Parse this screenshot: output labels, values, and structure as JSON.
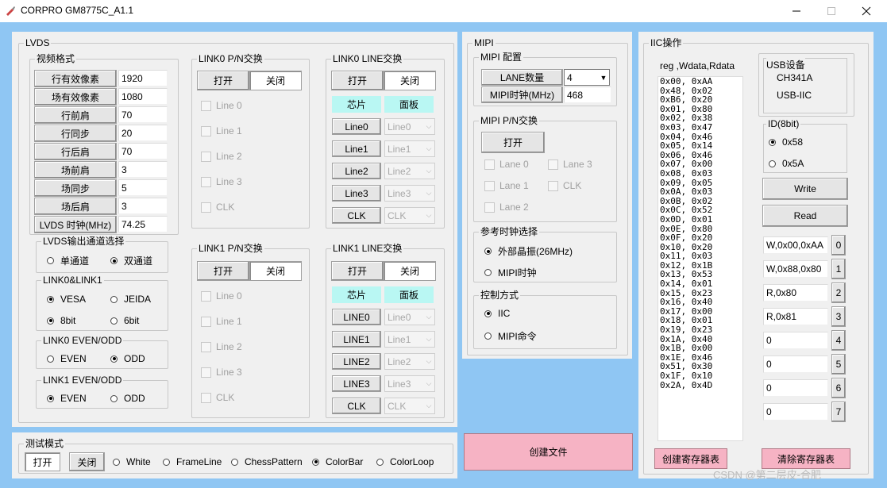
{
  "window": {
    "title": "CORPRO GM8775C_A1.1",
    "minimize_icon": "minimize-icon",
    "maximize_icon": "maximize-icon",
    "close_icon": "close-icon"
  },
  "lvds": {
    "title": "LVDS",
    "video_format": {
      "title": "视频格式",
      "rows": [
        {
          "label": "行有效像素",
          "value": "1920"
        },
        {
          "label": "场有效像素",
          "value": "1080"
        },
        {
          "label": "行前肩",
          "value": "70"
        },
        {
          "label": "行同步",
          "value": "20"
        },
        {
          "label": "行后肩",
          "value": "70"
        },
        {
          "label": "场前肩",
          "value": "3"
        },
        {
          "label": "场同步",
          "value": "5"
        },
        {
          "label": "场后肩",
          "value": "3"
        },
        {
          "label": "LVDS 时钟(MHz)",
          "value": "74.25"
        }
      ]
    },
    "output_channel": {
      "title": "LVDS输出通道选择",
      "options": [
        "单通道",
        "双通道"
      ],
      "selected": 1
    },
    "link": {
      "title": "LINK0&LINK1",
      "std_options": [
        "VESA",
        "JEIDA"
      ],
      "std_selected": 0,
      "bit_options": [
        "8bit",
        "6bit"
      ],
      "bit_selected": 0
    },
    "link0_evenodd": {
      "title": "LINK0 EVEN/ODD",
      "options": [
        "EVEN",
        "ODD"
      ],
      "selected": 1
    },
    "link1_evenodd": {
      "title": "LINK1 EVEN/ODD",
      "options": [
        "EVEN",
        "ODD"
      ],
      "selected": 0
    },
    "link0_pn": {
      "title": "LINK0 P/N交换",
      "open": "打开",
      "close": "关闭",
      "lines": [
        "Line 0",
        "Line 1",
        "Line 2",
        "Line 3",
        "CLK"
      ]
    },
    "link1_pn": {
      "title": "LINK1 P/N交换",
      "open": "打开",
      "close": "关闭",
      "lines": [
        "Line 0",
        "Line 1",
        "Line 2",
        "Line 3",
        "CLK"
      ]
    },
    "link0_line": {
      "title": "LINK0 LINE交换",
      "open": "打开",
      "close": "关闭",
      "chip": "芯片",
      "panel": "面板",
      "rows": [
        {
          "chip": "Line0",
          "panel": "Line0"
        },
        {
          "chip": "Line1",
          "panel": "Line1"
        },
        {
          "chip": "Line2",
          "panel": "Line2"
        },
        {
          "chip": "Line3",
          "panel": "Line3"
        },
        {
          "chip": "CLK",
          "panel": "CLK"
        }
      ]
    },
    "link1_line": {
      "title": "LINK1 LINE交换",
      "open": "打开",
      "close": "关闭",
      "chip": "芯片",
      "panel": "面板",
      "rows": [
        {
          "chip": "LINE0",
          "panel": "Line0"
        },
        {
          "chip": "LINE1",
          "panel": "Line1"
        },
        {
          "chip": "LINE2",
          "panel": "Line2"
        },
        {
          "chip": "LINE3",
          "panel": "Line3"
        },
        {
          "chip": "CLK",
          "panel": "CLK"
        }
      ]
    }
  },
  "test_mode": {
    "title": "测试模式",
    "open": "打开",
    "close": "关闭",
    "options": [
      "White",
      "FrameLine",
      "ChessPattern",
      "ColorBar",
      "ColorLoop"
    ],
    "selected": 3
  },
  "mipi": {
    "title": "MIPI",
    "config": {
      "title": "MIPI 配置",
      "lane_label": "LANE数量",
      "lane_value": "4",
      "clock_label": "MIPI时钟(MHz)",
      "clock_value": "468"
    },
    "pn": {
      "title": "MIPI P/N交换",
      "open": "打开",
      "lanes": [
        "Lane 0",
        "Lane 3",
        "Lane 1",
        "CLK",
        "Lane 2"
      ]
    },
    "ref_clock": {
      "title": "参考时钟选择",
      "options": [
        "外部晶振(26MHz)",
        "MIPI时钟"
      ],
      "selected": 0
    },
    "control": {
      "title": "控制方式",
      "options": [
        "IIC",
        "MIPI命令"
      ],
      "selected": 0
    }
  },
  "create_file_button": "创建文件",
  "iic": {
    "title": "IIC操作",
    "list_header": "reg ,Wdata,Rdata",
    "list": [
      "0x00, 0xAA",
      "0x48, 0x02",
      "0xB6, 0x20",
      "0x01, 0x80",
      "0x02, 0x38",
      "0x03, 0x47",
      "0x04, 0x46",
      "0x05, 0x14",
      "0x06, 0x46",
      "0x07, 0x00",
      "0x08, 0x03",
      "0x09, 0x05",
      "0x0A, 0x03",
      "0x0B, 0x02",
      "0x0C, 0x52",
      "0x0D, 0x01",
      "0x0E, 0x80",
      "0x0F, 0x20",
      "0x10, 0x20",
      "0x11, 0x03",
      "0x12, 0x1B",
      "0x13, 0x53",
      "0x14, 0x01",
      "0x15, 0x23",
      "0x16, 0x40",
      "0x17, 0x00",
      "0x18, 0x01",
      "0x19, 0x23",
      "0x1A, 0x40",
      "0x1B, 0x00",
      "0x1E, 0x46",
      "0x51, 0x30",
      "0x1F, 0x10",
      "0x2A, 0x4D"
    ],
    "usb": {
      "title": "USB设备",
      "line1": "CH341A",
      "line2": "USB-IIC"
    },
    "id": {
      "title": "ID(8bit)",
      "options": [
        "0x58",
        "0x5A"
      ],
      "selected": 0
    },
    "write": "Write",
    "read": "Read",
    "cmds": [
      {
        "value": "W,0x00,0xAA",
        "num": "0"
      },
      {
        "value": "W,0x88,0x80",
        "num": "1"
      },
      {
        "value": "R,0x80",
        "num": "2"
      },
      {
        "value": "R,0x81",
        "num": "3"
      },
      {
        "value": "0",
        "num": "4"
      },
      {
        "value": "0",
        "num": "5"
      },
      {
        "value": "0",
        "num": "6"
      },
      {
        "value": "0",
        "num": "7"
      }
    ],
    "create_reg_table": "创建寄存器表",
    "clear_reg_table": "清除寄存器表"
  },
  "watermark": "CSDN @第二层皮-合肥"
}
